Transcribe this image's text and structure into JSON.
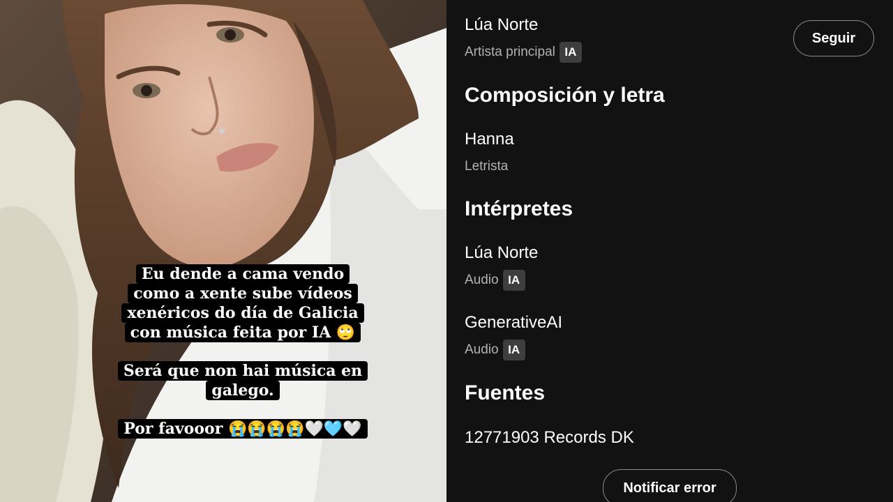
{
  "story": {
    "caption_lines_1": [
      "Eu dende a cama vendo",
      "como a xente sube vídeos",
      "xenéricos do día de Galicia",
      "con música feita por IA 🙄"
    ],
    "caption_lines_2": [
      "Será que non hai música en",
      "galego."
    ],
    "caption_lines_3": [
      "Por favooor 😭😭😭😭🤍🩵🤍"
    ]
  },
  "credits": {
    "main_artist": {
      "name": "Lúa Norte",
      "role": "Artista principal",
      "badge": "IA"
    },
    "follow_label": "Seguir",
    "composition": {
      "title": "Composición y letra",
      "name": "Hanna",
      "role": "Letrista"
    },
    "performers": {
      "title": "Intérpretes",
      "items": [
        {
          "name": "Lúa Norte",
          "role": "Audio",
          "badge": "IA"
        },
        {
          "name": "GenerativeAI",
          "role": "Audio",
          "badge": "IA"
        }
      ]
    },
    "sources": {
      "title": "Fuentes",
      "name": "12771903 Records DK"
    },
    "report_label": "Notificar error"
  },
  "colors": {
    "panel_bg": "#121212",
    "secondary_text": "#b3b3b3",
    "badge_bg": "#3e3e3e",
    "caption_bg": "#000000"
  }
}
